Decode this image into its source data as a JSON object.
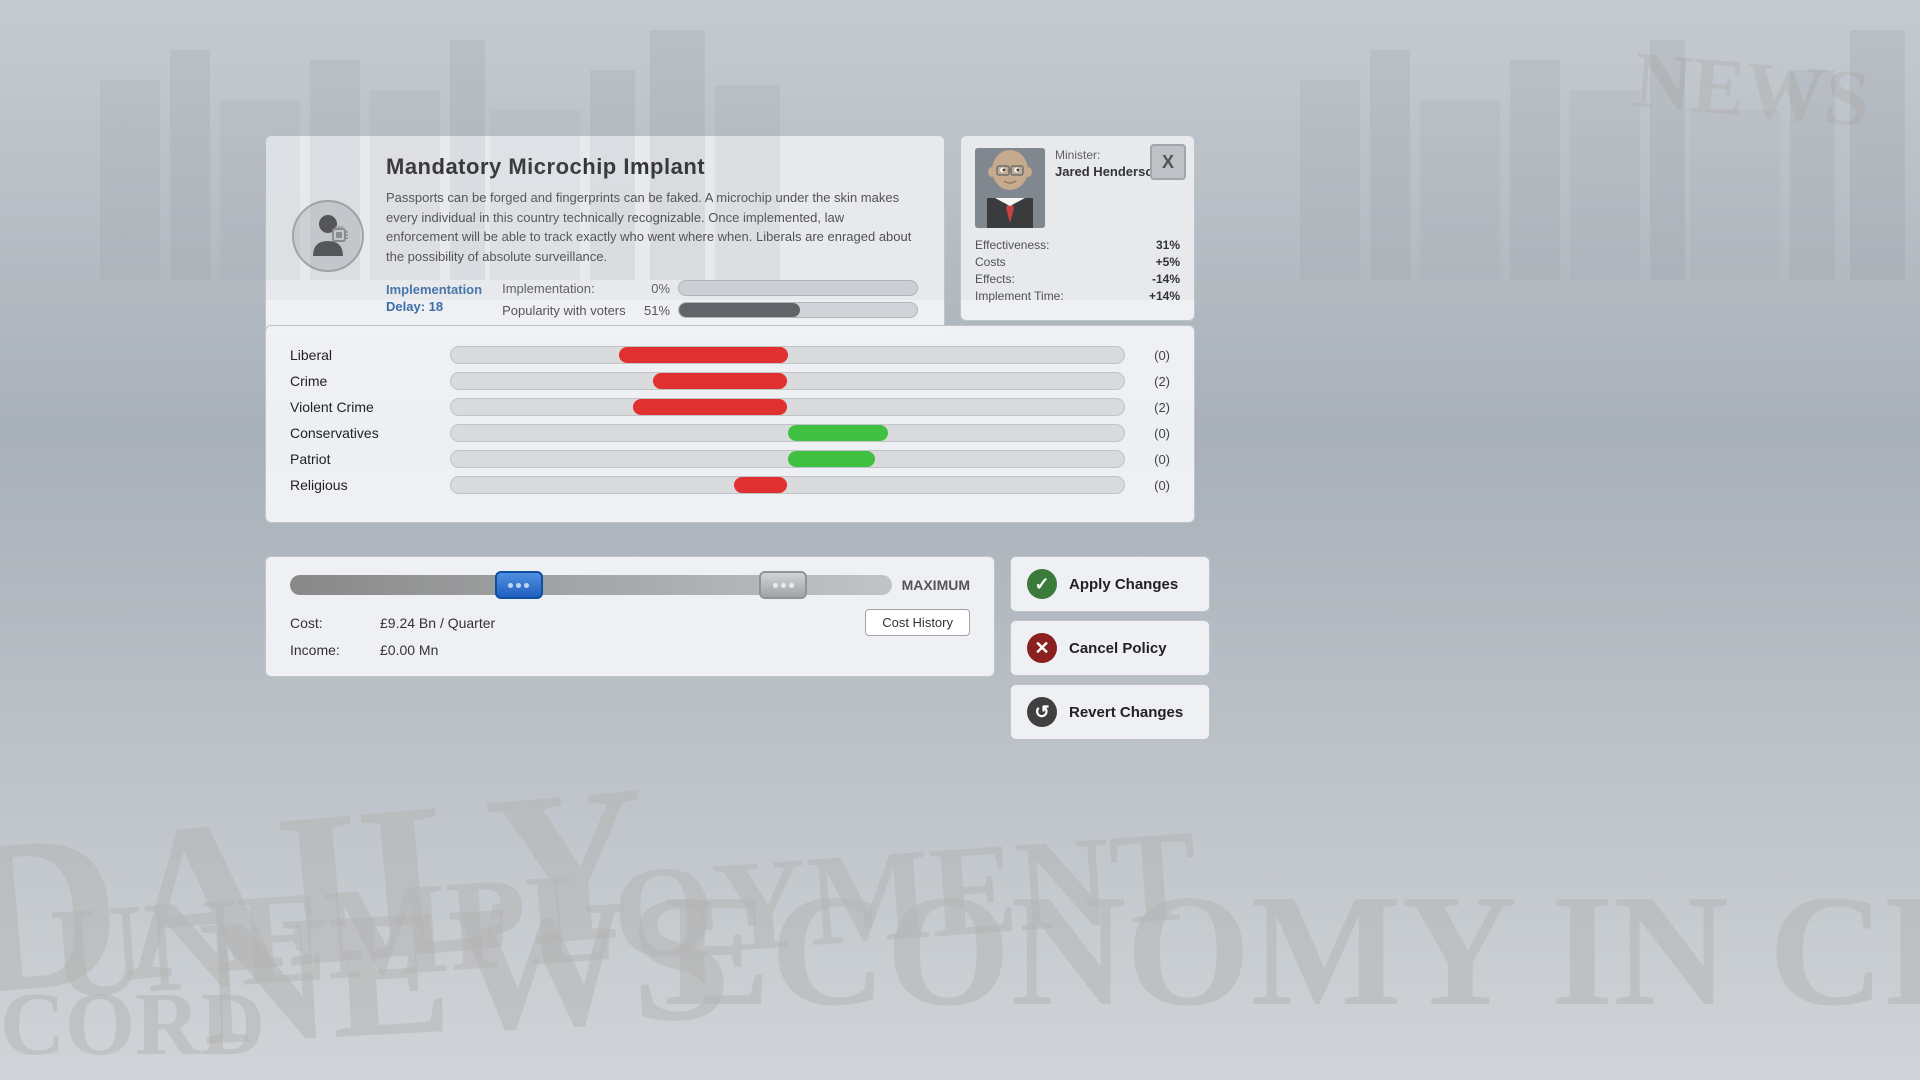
{
  "background": {
    "newspaper_words": [
      "DAILY",
      "NEWS",
      "UNEMPLOYMENT",
      "ECONOMY IN CR",
      "CORD"
    ]
  },
  "policy": {
    "title": "Mandatory Microchip Implant",
    "description": "Passports can be forged and fingerprints can be faked. A microchip under the skin makes every individual in this country technically recognizable. Once implemented, law enforcement will be able to track exactly who went where when. Liberals are enraged about the possibility of absolute surveillance.",
    "impl_delay_label": "Implementation\nDelay: 18",
    "impl_label": "Implementation:",
    "impl_pct": "0%",
    "popularity_label": "Popularity with voters",
    "popularity_pct": "51%"
  },
  "minister": {
    "label": "Minister:",
    "name": "Jared Henderson",
    "stats": {
      "effectiveness_label": "Effectiveness:",
      "effectiveness_value": "31%",
      "costs_label": "Costs",
      "costs_value": "+5%",
      "effects_label": "Effects:",
      "effects_value": "-14%",
      "implement_time_label": "Implement Time:",
      "implement_time_value": "+14%"
    }
  },
  "close_btn": "X",
  "effects": [
    {
      "label": "Liberal",
      "direction": "left",
      "value": "(0)",
      "bar_pct": 25,
      "color": "red"
    },
    {
      "label": "Crime",
      "direction": "left",
      "value": "(2)",
      "bar_pct": 20,
      "color": "red"
    },
    {
      "label": "Violent Crime",
      "direction": "left",
      "value": "(2)",
      "bar_pct": 23,
      "color": "red"
    },
    {
      "label": "Conservatives",
      "direction": "right",
      "value": "(0)",
      "bar_pct": 15,
      "color": "green"
    },
    {
      "label": "Patriot",
      "direction": "right",
      "value": "(0)",
      "bar_pct": 13,
      "color": "green"
    },
    {
      "label": "Religious",
      "direction": "left",
      "value": "(0)",
      "bar_pct": 8,
      "color": "red"
    }
  ],
  "funding": {
    "max_label": "MAXIMUM",
    "cost_label": "Cost:",
    "cost_value": "£9.24 Bn / Quarter",
    "income_label": "Income:",
    "income_value": "£0.00 Mn",
    "cost_history_btn": "Cost History"
  },
  "actions": {
    "apply_label": "Apply Changes",
    "cancel_label": "Cancel Policy",
    "revert_label": "Revert Changes"
  }
}
